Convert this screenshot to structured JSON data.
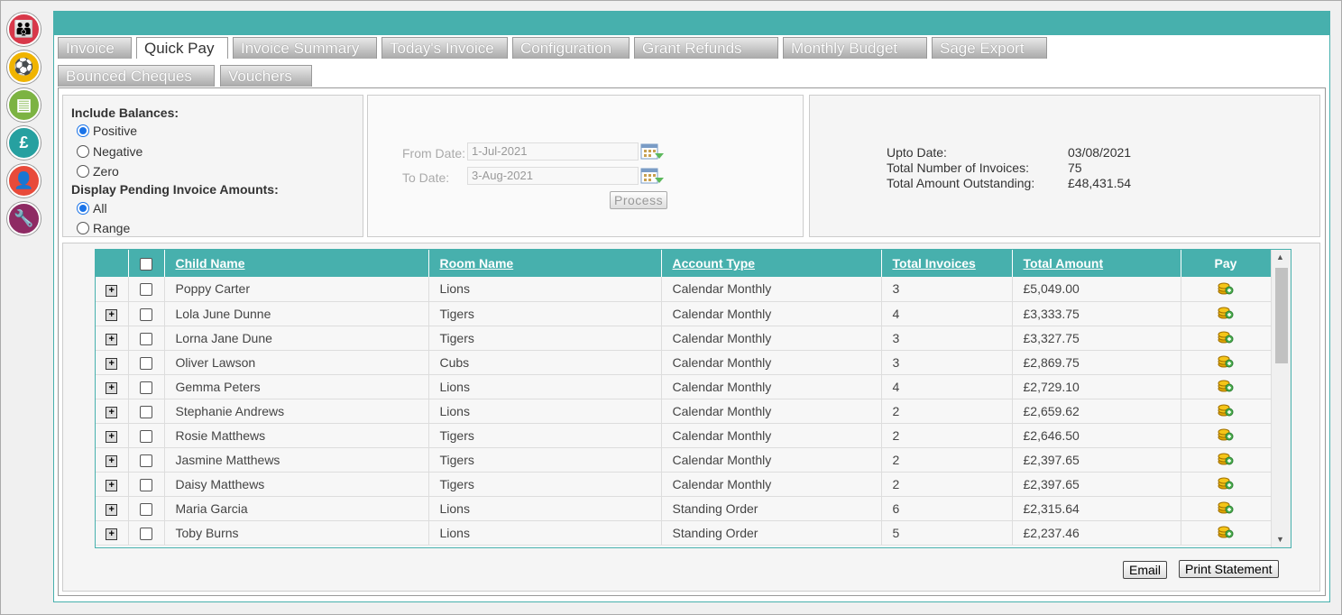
{
  "nav_icons": [
    {
      "name": "family-icon",
      "color": "#d8384a",
      "glyph": "👪"
    },
    {
      "name": "child-play-icon",
      "color": "#f0b400",
      "glyph": "⚽"
    },
    {
      "name": "document-icon",
      "color": "#7cb342",
      "glyph": "▤"
    },
    {
      "name": "pound-icon",
      "color": "#26a0a0",
      "glyph": "£"
    },
    {
      "name": "staff-icon",
      "color": "#e84a3a",
      "glyph": "👤"
    },
    {
      "name": "wrench-icon",
      "color": "#8e2a63",
      "glyph": "🔧"
    }
  ],
  "tabs": {
    "invoice": "Invoice",
    "quick_pay": "Quick Pay",
    "invoice_summary": "Invoice Summary",
    "todays_invoice": "Today's Invoice",
    "configuration": "Configuration",
    "grant_refunds": "Grant Refunds",
    "monthly_budget": "Monthly Budget",
    "sage_export": "Sage Export",
    "bounced_cheques": "Bounced Cheques",
    "vouchers": "Vouchers"
  },
  "filters": {
    "include_balances_label": "Include Balances:",
    "positive": "Positive",
    "negative": "Negative",
    "zero": "Zero",
    "display_pending_label": "Display Pending Invoice Amounts:",
    "all": "All",
    "range": "Range"
  },
  "dates": {
    "from_label": "From Date:",
    "from_value": "1-Jul-2021",
    "to_label": "To Date:",
    "to_value": "3-Aug-2021",
    "process": "Process"
  },
  "summary": {
    "upto_label": "Upto Date:",
    "upto_value": "03/08/2021",
    "count_label": "Total Number of Invoices:",
    "count_value": "75",
    "outstanding_label": "Total Amount Outstanding:",
    "outstanding_value": "£48,431.54"
  },
  "table": {
    "headers": {
      "child": "Child Name",
      "room": "Room Name",
      "account": "Account Type",
      "invoices": "Total Invoices",
      "amount": "Total Amount",
      "pay": "Pay"
    },
    "rows": [
      {
        "child": "Poppy Carter",
        "room": "Lions",
        "account": "Calendar Monthly",
        "invoices": "3",
        "amount": "£5,049.00"
      },
      {
        "child": "Lola June Dunne",
        "room": "Tigers",
        "account": "Calendar Monthly",
        "invoices": "4",
        "amount": "£3,333.75"
      },
      {
        "child": "Lorna Jane Dune",
        "room": "Tigers",
        "account": "Calendar Monthly",
        "invoices": "3",
        "amount": "£3,327.75"
      },
      {
        "child": "Oliver Lawson",
        "room": "Cubs",
        "account": "Calendar Monthly",
        "invoices": "3",
        "amount": "£2,869.75"
      },
      {
        "child": "Gemma Peters",
        "room": "Lions",
        "account": "Calendar Monthly",
        "invoices": "4",
        "amount": "£2,729.10"
      },
      {
        "child": "Stephanie Andrews",
        "room": "Lions",
        "account": "Calendar Monthly",
        "invoices": "2",
        "amount": "£2,659.62"
      },
      {
        "child": "Rosie Matthews",
        "room": "Tigers",
        "account": "Calendar Monthly",
        "invoices": "2",
        "amount": "£2,646.50"
      },
      {
        "child": "Jasmine Matthews",
        "room": "Tigers",
        "account": "Calendar Monthly",
        "invoices": "2",
        "amount": "£2,397.65"
      },
      {
        "child": "Daisy Matthews",
        "room": "Tigers",
        "account": "Calendar Monthly",
        "invoices": "2",
        "amount": "£2,397.65"
      },
      {
        "child": "Maria Garcia",
        "room": "Lions",
        "account": "Standing Order",
        "invoices": "6",
        "amount": "£2,315.64"
      },
      {
        "child": "Toby Burns",
        "room": "Lions",
        "account": "Standing Order",
        "invoices": "5",
        "amount": "£2,237.46"
      }
    ]
  },
  "actions": {
    "email": "Email",
    "print": "Print Statement"
  },
  "colors": {
    "accent": "#47b0ad"
  }
}
